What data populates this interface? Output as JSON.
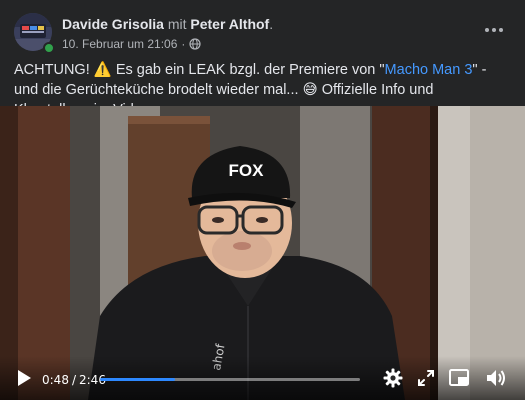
{
  "post": {
    "author": "Davide Grisolia",
    "with_word": "mit",
    "coauthor": "Peter Althof",
    "period": ".",
    "date": "10. Februar um 21:06",
    "dot": "·",
    "text": {
      "part1": "ACHTUNG! ",
      "warning_emoji": "⚠️",
      "part2": " Es gab ein LEAK bzgl. der Premiere von \"",
      "link": "Macho Man 3",
      "part3": "\" - und die Gerüchteküche brodelt wieder mal... ",
      "face_emoji": "😅",
      "part4": " Offizielle Info und Klarstellung im Video."
    }
  },
  "video": {
    "current_time": "0:48",
    "separator": "/",
    "duration": "2:46",
    "progress": 0.29,
    "cap_text": "FOX",
    "shirt_text": "ahof"
  },
  "icons": {
    "more": "more-horizontal-icon",
    "globe": "globe-icon",
    "play": "play-icon",
    "settings": "gear-icon",
    "expand": "expand-icon",
    "pip": "picture-in-picture-icon",
    "volume": "volume-icon"
  },
  "colors": {
    "background": "#242526",
    "text": "#e4e6eb",
    "secondary_text": "#b0b3b8",
    "link": "#4599ff",
    "progress": "#2d88ff",
    "online": "#31a24c"
  }
}
